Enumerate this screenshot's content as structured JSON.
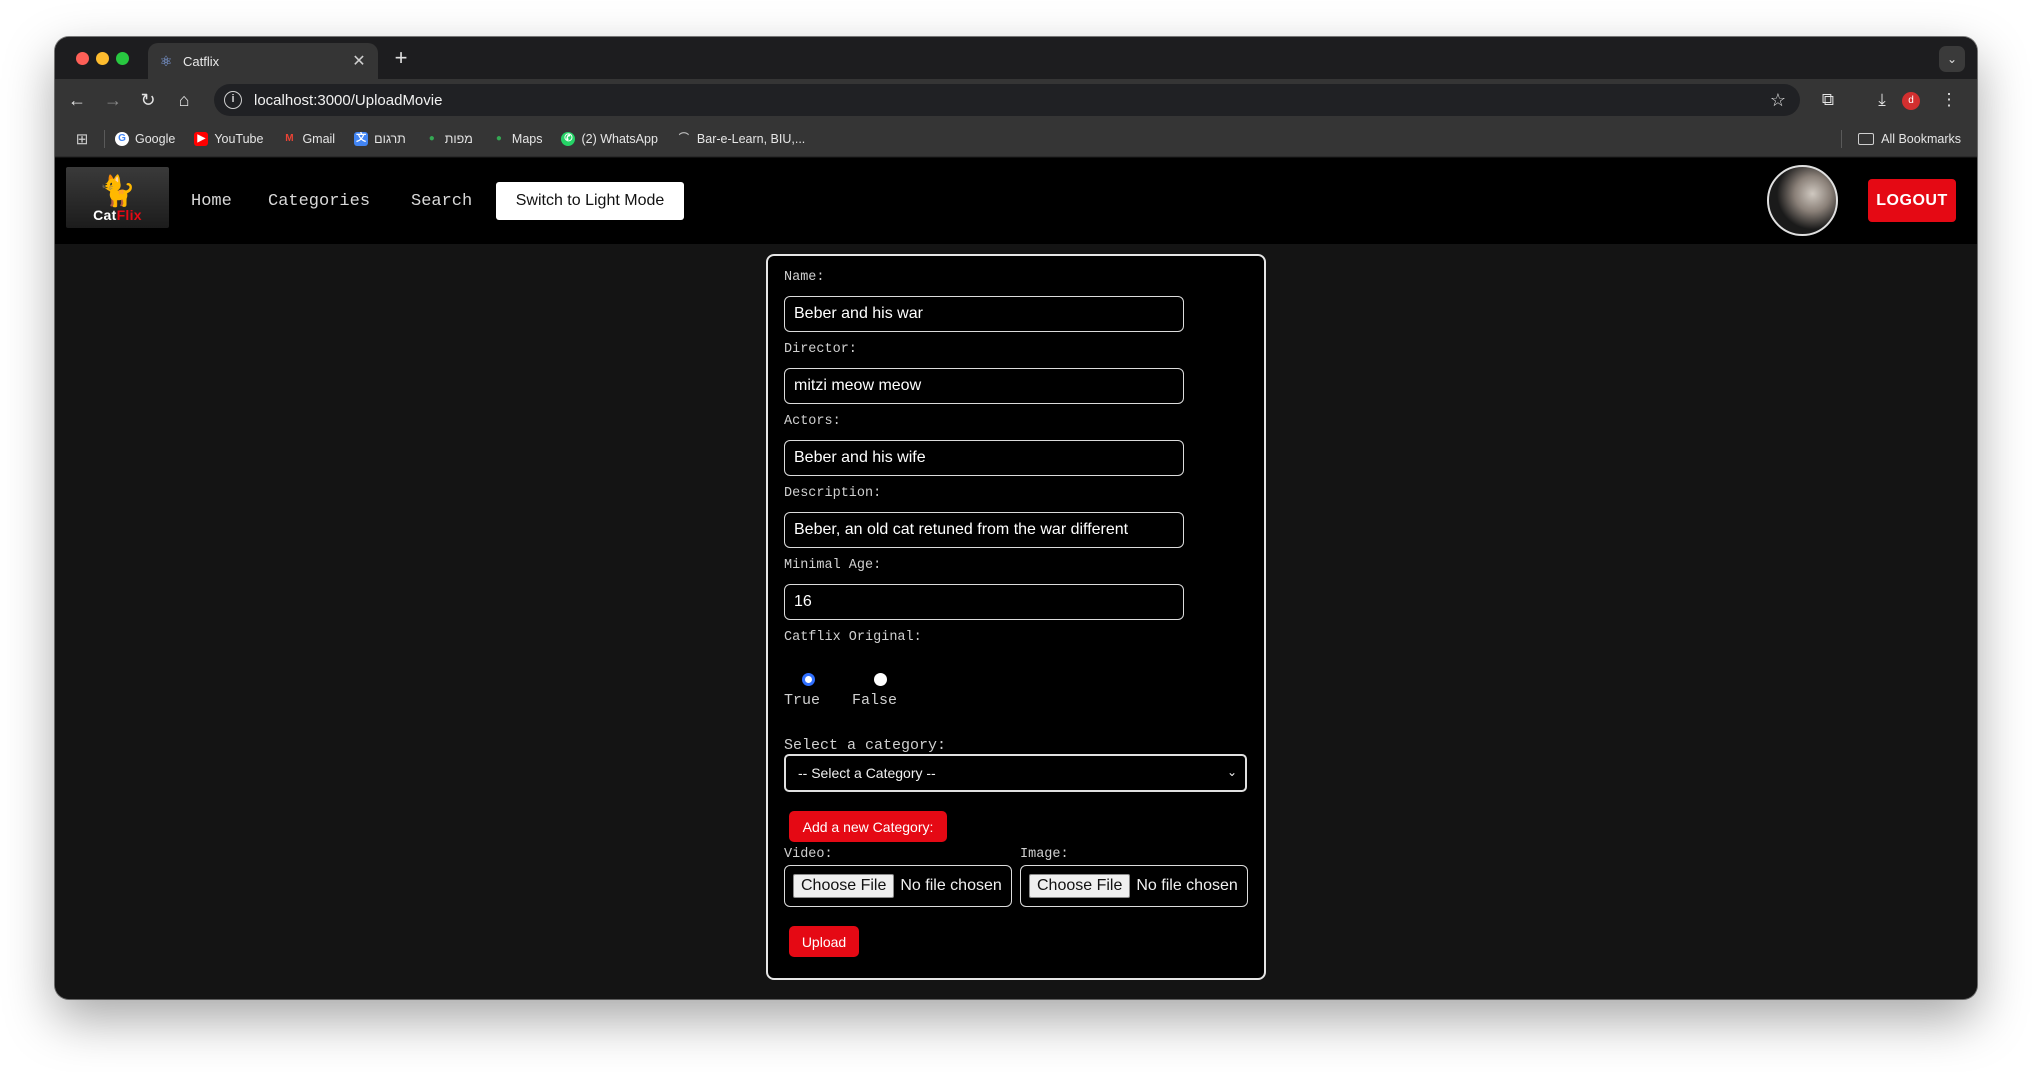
{
  "browser": {
    "tab_title": "Catflix",
    "url": "localhost:3000/UploadMovie",
    "profile_initial": "d",
    "bookmarks": [
      {
        "label": "Google",
        "icon": "google-icon",
        "color": "#4285f4"
      },
      {
        "label": "YouTube",
        "icon": "youtube-icon",
        "color": "#ff0000"
      },
      {
        "label": "Gmail",
        "icon": "gmail-icon",
        "color": "#ea4335"
      },
      {
        "label": "תרגום",
        "icon": "translate-icon",
        "color": "#4285f4"
      },
      {
        "label": "מפות",
        "icon": "maps-icon",
        "color": "#34a853"
      },
      {
        "label": "Maps",
        "icon": "maps-icon",
        "color": "#34a853"
      },
      {
        "label": "(2) WhatsApp",
        "icon": "whatsapp-icon",
        "color": "#25d366"
      },
      {
        "label": "Bar-e-Learn, BIU,...",
        "icon": "elearn-icon",
        "color": "#888888"
      }
    ],
    "all_bookmarks": "All Bookmarks"
  },
  "navbar": {
    "logo_prefix": "Cat",
    "logo_suffix": "Flix",
    "links": [
      "Home",
      "Categories",
      "Search"
    ],
    "mode_button": "Switch to Light Mode",
    "logout": "LOGOUT"
  },
  "form": {
    "name_label": "Name:",
    "name_value": "Beber and his war",
    "director_label": "Director:",
    "director_value": "mitzi meow meow",
    "actors_label": "Actors:",
    "actors_value": "Beber and his wife",
    "description_label": "Description:",
    "description_value": "Beber, an old cat retuned from the war different",
    "age_label": "Minimal Age:",
    "age_value": "16",
    "original_label": "Catflix Original:",
    "true_label": "True",
    "false_label": "False",
    "category_label": "Select a category:",
    "category_selected": "-- Select a Category --",
    "add_category": "Add a new Category:",
    "video_label": "Video:",
    "image_label": "Image:",
    "choose_file": "Choose File",
    "no_file": "No file chosen",
    "upload": "Upload"
  },
  "colors": {
    "accent": "#e50914",
    "page_bg": "#141414",
    "navbar_bg": "#000000"
  }
}
